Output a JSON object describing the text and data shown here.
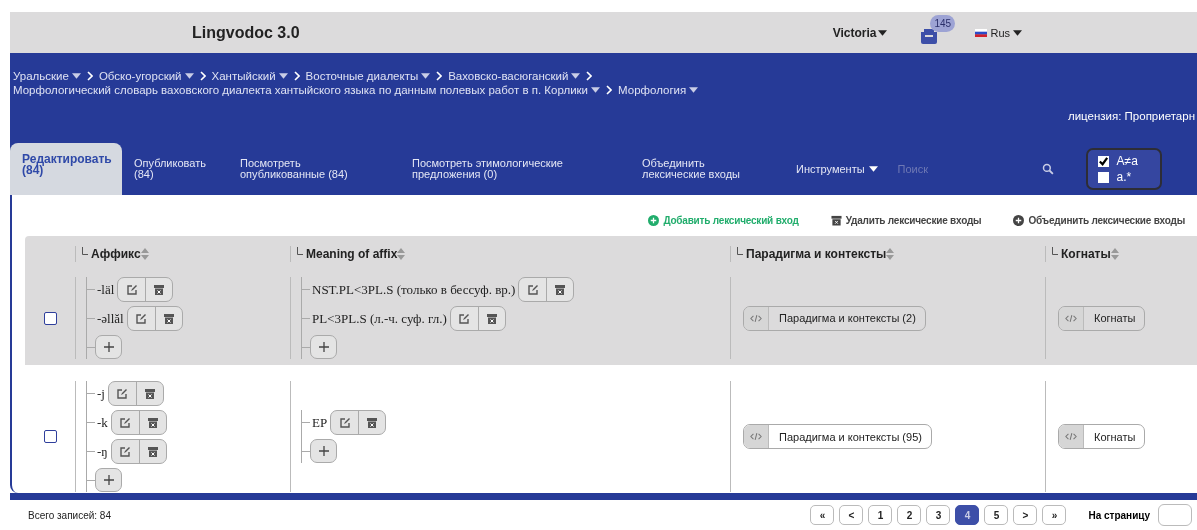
{
  "header": {
    "title": "Lingvodoc 3.0",
    "user": "Victoria",
    "notifications": "145",
    "language": "Rus"
  },
  "breadcrumbs": [
    [
      {
        "label": "Уральские"
      },
      {
        "label": "Обско-угорский"
      },
      {
        "label": "Хантыйский"
      },
      {
        "label": "Восточные диалекты"
      },
      {
        "label": "Ваховско-васюганский"
      }
    ],
    [
      {
        "label": "Морфологический словарь ваховского диалекта хантыйского языка по данным полевых работ в п. Корлики"
      },
      {
        "label": "Морфология"
      }
    ]
  ],
  "license": "лицензия: Проприетарн",
  "tabs": [
    {
      "label": "Редактировать (84)",
      "selected": true
    },
    {
      "label": "Опубликовать (84)",
      "selected": false
    },
    {
      "label": "Посмотреть опубликованные (84)",
      "selected": false
    },
    {
      "label": "Посмотреть этимологические предложения (0)",
      "selected": false
    },
    {
      "label": "Объединить лексические входы",
      "selected": false
    }
  ],
  "tools_menu": "Инструменты",
  "search": {
    "placeholder": "Поиск"
  },
  "filters": [
    {
      "label": "A≠a",
      "checked": true
    },
    {
      "label": "a.*",
      "checked": false
    }
  ],
  "actions": [
    {
      "label": "Добавить лексический вход",
      "kind": "add"
    },
    {
      "label": "Удалить лексические входы",
      "kind": "delete"
    },
    {
      "label": "Объединить лексические входы",
      "kind": "merge"
    }
  ],
  "table": {
    "columns": [
      "Аффикс",
      "Meaning of affix",
      "Парадигма и контексты",
      "Когнаты"
    ],
    "rows": [
      {
        "selected": false,
        "highlighted": true,
        "affixes": [
          "-läl",
          "-əllăl"
        ],
        "meanings": [
          "NST.PL<3PL.S (только в бессуф. вр.)",
          "PL<3PL.S (л.-ч. суф. гл.)"
        ],
        "paradigm": "Парадигма и контексты (2)",
        "cognates": "Когнаты"
      },
      {
        "selected": false,
        "highlighted": false,
        "affixes": [
          "-j",
          "-k",
          "-ŋ"
        ],
        "meanings": [
          "EP"
        ],
        "paradigm": "Парадигма и контексты (95)",
        "cognates": "Когнаты"
      }
    ]
  },
  "footer": {
    "total": "Всего записей: 84",
    "pages": [
      {
        "label": "«",
        "selected": false
      },
      {
        "label": "<",
        "selected": false
      },
      {
        "label": "1",
        "selected": false
      },
      {
        "label": "2",
        "selected": false
      },
      {
        "label": "3",
        "selected": false
      },
      {
        "label": "4",
        "selected": true
      },
      {
        "label": "5",
        "selected": false
      },
      {
        "label": ">",
        "selected": false
      },
      {
        "label": "»",
        "selected": false
      }
    ],
    "per_page": "На страницу"
  }
}
